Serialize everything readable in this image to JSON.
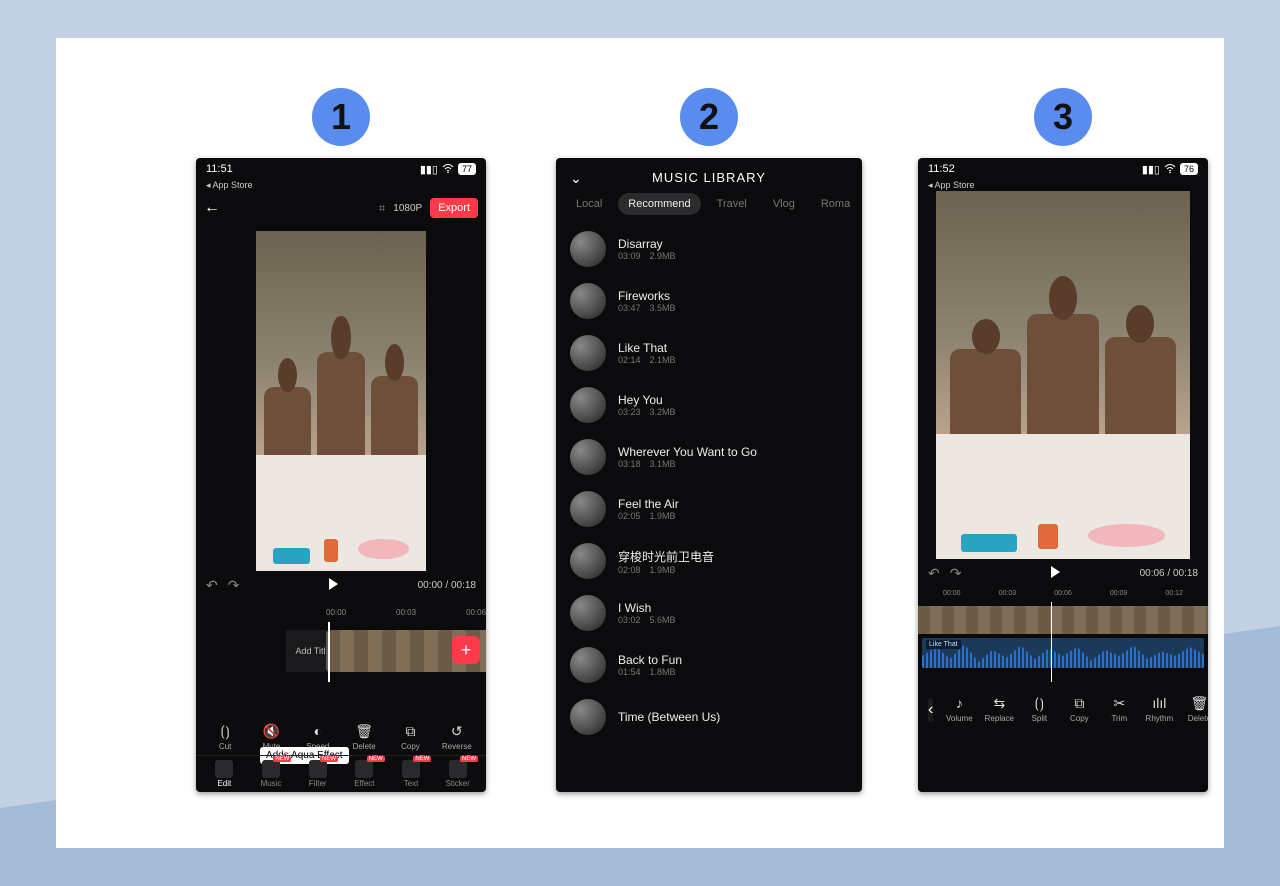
{
  "badges": [
    "1",
    "2",
    "3"
  ],
  "phone1": {
    "status": {
      "time": "11:51",
      "back": "◂ App Store",
      "battery": "77"
    },
    "topbar": {
      "resolution": "1080P",
      "export": "Export"
    },
    "play": {
      "current": "00:00",
      "total": "00:18"
    },
    "timeline": {
      "ruler": [
        "00:00",
        "00:03",
        "00:06"
      ],
      "add_title": "Add Title"
    },
    "tooltip": "Adds Aqua Effect",
    "tools": [
      {
        "name": "cut",
        "label": "Cut",
        "glyph": "⟮⟯"
      },
      {
        "name": "mute",
        "label": "Mute",
        "glyph": "🔇"
      },
      {
        "name": "speed",
        "label": "Speed",
        "glyph": "◐"
      },
      {
        "name": "delete",
        "label": "Delete",
        "glyph": "🗑"
      },
      {
        "name": "copy",
        "label": "Copy",
        "glyph": "⧉"
      },
      {
        "name": "reverse",
        "label": "Reverse",
        "glyph": "↺"
      }
    ],
    "tabs": [
      {
        "name": "edit",
        "label": "Edit",
        "new": false,
        "active": true
      },
      {
        "name": "music",
        "label": "Music",
        "new": true
      },
      {
        "name": "filter",
        "label": "Filter",
        "new": true
      },
      {
        "name": "effect",
        "label": "Effect",
        "new": true
      },
      {
        "name": "text",
        "label": "Text",
        "new": true
      },
      {
        "name": "sticker",
        "label": "Sticker",
        "new": true
      }
    ]
  },
  "phone2": {
    "title": "MUSIC LIBRARY",
    "tabs": [
      "Local",
      "Recommend",
      "Travel",
      "Vlog",
      "Roma"
    ],
    "active_tab": "Recommend",
    "tracks": [
      {
        "name": "Disarray",
        "dur": "03:09",
        "size": "2.9MB"
      },
      {
        "name": "Fireworks",
        "dur": "03:47",
        "size": "3.5MB"
      },
      {
        "name": "Like That",
        "dur": "02:14",
        "size": "2.1MB"
      },
      {
        "name": "Hey You",
        "dur": "03:23",
        "size": "3.2MB"
      },
      {
        "name": "Wherever You Want to Go",
        "dur": "03:18",
        "size": "3.1MB"
      },
      {
        "name": "Feel the Air",
        "dur": "02:05",
        "size": "1.9MB"
      },
      {
        "name": "穿梭时光前卫电音",
        "dur": "02:08",
        "size": "1.9MB"
      },
      {
        "name": "I Wish",
        "dur": "03:02",
        "size": "5.6MB"
      },
      {
        "name": "Back to Fun",
        "dur": "01:54",
        "size": "1.8MB"
      },
      {
        "name": "Time (Between Us)",
        "dur": "",
        "size": ""
      }
    ]
  },
  "phone3": {
    "status": {
      "time": "11:52",
      "back": "◂ App Store",
      "battery": "76"
    },
    "play": {
      "current": "00:06",
      "total": "00:18"
    },
    "timeline": {
      "ruler": [
        "00:00",
        "00:03",
        "00:06",
        "00:09",
        "00:12"
      ],
      "audio_label": "Like That"
    },
    "tools": [
      {
        "name": "volume",
        "label": "Volume",
        "glyph": "♪"
      },
      {
        "name": "replace",
        "label": "Replace",
        "glyph": "⇆"
      },
      {
        "name": "split",
        "label": "Split",
        "glyph": "⟮⟯"
      },
      {
        "name": "copy",
        "label": "Copy",
        "glyph": "⧉"
      },
      {
        "name": "trim",
        "label": "Trim",
        "glyph": "✂"
      },
      {
        "name": "rhythm",
        "label": "Rhythm",
        "glyph": "ılıl"
      },
      {
        "name": "delete",
        "label": "Delete",
        "glyph": "🗑"
      }
    ]
  },
  "labels": {
    "new": "NEW",
    "sep": " / "
  }
}
